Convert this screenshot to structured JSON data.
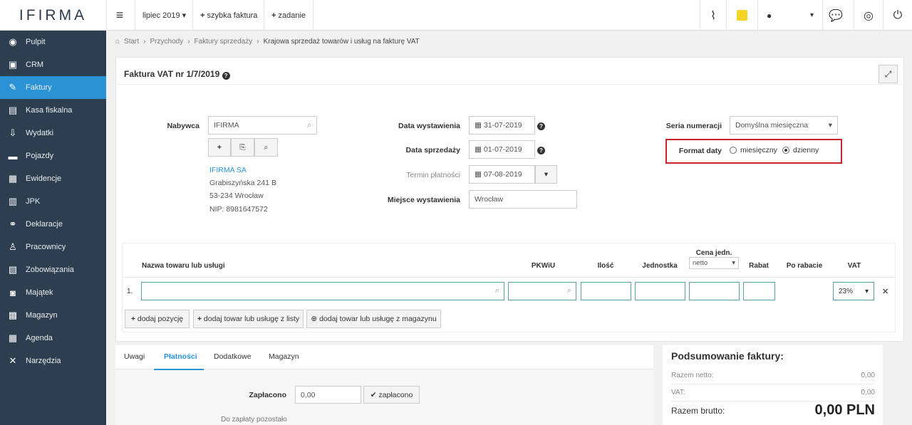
{
  "logo": {
    "text_a": "I",
    "text_b": "FIRMA"
  },
  "topbar": {
    "period": "lipiec 2019",
    "quick_invoice": "szybka faktura",
    "task": "zadanie"
  },
  "sidebar": {
    "items": [
      {
        "label": "Pulpit",
        "icon": "dashboard-icon"
      },
      {
        "label": "CRM",
        "icon": "contacts-icon"
      },
      {
        "label": "Faktury",
        "icon": "invoice-icon",
        "active": true
      },
      {
        "label": "Kasa fiskalna",
        "icon": "register-icon"
      },
      {
        "label": "Wydatki",
        "icon": "expenses-icon"
      },
      {
        "label": "Pojazdy",
        "icon": "truck-icon"
      },
      {
        "label": "Ewidencje",
        "icon": "records-icon"
      },
      {
        "label": "JPK",
        "icon": "jpk-icon"
      },
      {
        "label": "Deklaracje",
        "icon": "declarations-icon"
      },
      {
        "label": "Pracownicy",
        "icon": "employees-icon"
      },
      {
        "label": "Zobowiązania",
        "icon": "liabilities-icon"
      },
      {
        "label": "Majątek",
        "icon": "camera-icon"
      },
      {
        "label": "Magazyn",
        "icon": "warehouse-icon"
      },
      {
        "label": "Agenda",
        "icon": "calendar-icon"
      },
      {
        "label": "Narzędzia",
        "icon": "tools-icon"
      }
    ]
  },
  "breadcrumb": {
    "start": "Start",
    "b1": "Przychody",
    "b2": "Faktury sprzedaży",
    "current": "Krajowa sprzedaż towarów i usług na fakturę VAT"
  },
  "invoice": {
    "title": "Faktura VAT nr 1/7/2019",
    "buyer_label": "Nabywca",
    "buyer_value": "IFIRMA",
    "addr_name": "IFIRMA SA",
    "addr_street": "Grabiszyńska 241 B",
    "addr_city": "53-234 Wrocław",
    "addr_nip": "NIP: 8981647572",
    "issue_date_label": "Data wystawienia",
    "issue_date": "31-07-2019",
    "sale_date_label": "Data sprzedaży",
    "sale_date": "01-07-2019",
    "due_label": "Termin płatności",
    "due_date": "07-08-2019",
    "place_label": "Miejsce wystawienia",
    "place_value": "Wrocław",
    "series_label": "Seria numeracji",
    "series_value": "Domyślna miesięczna",
    "date_format_label": "Format daty",
    "date_format_monthly": "miesięczny",
    "date_format_daily": "dzienny"
  },
  "table": {
    "headers": {
      "name": "Nazwa towaru lub usługi",
      "pkwiu": "PKWiU",
      "qty": "Ilość",
      "unit": "Jednostka",
      "price": "Cena jedn.",
      "price_mode": "netto",
      "discount": "Rabat",
      "after": "Po rabacie",
      "vat": "VAT"
    },
    "row_no": "1.",
    "vat_value": "23%",
    "add_position": "dodaj pozycję",
    "add_from_list": "dodaj towar lub usługę z listy",
    "add_from_stock": "dodaj towar lub usługę z magazynu"
  },
  "tabs": {
    "t1": "Uwagi",
    "t2": "Płatności",
    "t3": "Dodatkowe",
    "t4": "Magazyn"
  },
  "payment": {
    "paid_label": "Zapłacono",
    "paid_value": "0,00",
    "paid_button": "zapłacono",
    "remaining_label": "Do zapłaty pozostało"
  },
  "summary": {
    "title": "Podsumowanie faktury:",
    "net_label": "Razem netto:",
    "net_value": "0,00",
    "vat_label": "VAT:",
    "vat_value": "0,00",
    "gross_label": "Razem brutto:",
    "gross_value": "0,00 PLN"
  },
  "colors": {
    "accent": "#2a93d5",
    "sidebar": "#2d3e50",
    "highlight": "#c8252c"
  }
}
